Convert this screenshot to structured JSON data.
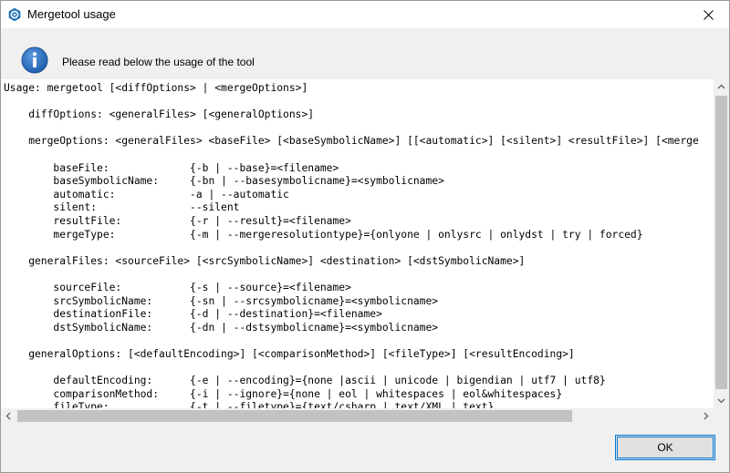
{
  "window": {
    "title": "Mergetool usage",
    "app_icon": "mergetool-app-icon",
    "close_icon": "close-icon"
  },
  "header": {
    "icon": "info-icon",
    "text": "Please read below the usage of the tool"
  },
  "usage_lines": [
    "Usage: mergetool [<diffOptions> | <mergeOptions>]",
    "",
    "    diffOptions: <generalFiles> [<generalOptions>]",
    "",
    "    mergeOptions: <generalFiles> <baseFile> [<baseSymbolicName>] [[<automatic>] [<silent>] <resultFile>] [<merge",
    "",
    "        baseFile:             {-b | --base}=<filename>",
    "        baseSymbolicName:     {-bn | --basesymbolicname}=<symbolicname>",
    "        automatic:            -a | --automatic",
    "        silent:               --silent",
    "        resultFile:           {-r | --result}=<filename>",
    "        mergeType:            {-m | --mergeresolutiontype}={onlyone | onlysrc | onlydst | try | forced}",
    "",
    "    generalFiles: <sourceFile> [<srcSymbolicName>] <destination> [<dstSymbolicName>]",
    "",
    "        sourceFile:           {-s | --source}=<filename>",
    "        srcSymbolicName:      {-sn | --srcsymbolicname}=<symbolicname>",
    "        destinationFile:      {-d | --destination}=<filename>",
    "        dstSymbolicName:      {-dn | --dstsymbolicname}=<symbolicname>",
    "",
    "    generalOptions: [<defaultEncoding>] [<comparisonMethod>] [<fileType>] [<resultEncoding>]",
    "",
    "        defaultEncoding:      {-e | --encoding}={none |ascii | unicode | bigendian | utf7 | utf8}",
    "        comparisonMethod:     {-i | --ignore}={none | eol | whitespaces | eol&whitespaces}",
    "        fileType:             {-t | --filetype}={text/csharp | text/XML | text}"
  ],
  "scrollbars": {
    "up_icon": "scroll-up-arrow-icon",
    "down_icon": "scroll-down-arrow-icon",
    "left_icon": "scroll-left-arrow-icon",
    "right_icon": "scroll-right-arrow-icon"
  },
  "buttons": {
    "ok_label": "OK"
  },
  "colors": {
    "accent": "#0078d7",
    "dialog_background": "#f0f0f0",
    "info_icon_blue": "#2a6ab8",
    "scroll_thumb": "#c2c2c2"
  }
}
